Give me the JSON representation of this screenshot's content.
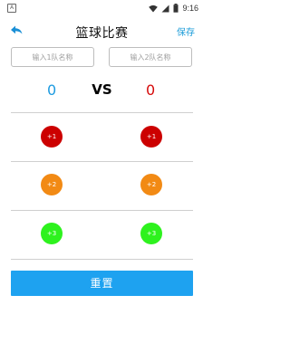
{
  "status_bar": {
    "time": "9:16",
    "notification_icon": "A"
  },
  "app_bar": {
    "title": "篮球比赛",
    "save_label": "保存"
  },
  "teams": {
    "team1_placeholder": "输入1队名称",
    "team2_placeholder": "输入2队名称",
    "team1_value": "",
    "team2_value": ""
  },
  "scores": {
    "team1": "0",
    "vs": "VS",
    "team2": "0"
  },
  "buttons": {
    "plus1": "+1",
    "plus2": "+2",
    "plus3": "+3",
    "reset": "重置"
  },
  "colors": {
    "accent": "#1ea2f0",
    "team1_score": "#1e9be0",
    "team2_score": "#d60b0b",
    "plus1": "#cc0000",
    "plus2": "#f28a14",
    "plus3": "#2ef21e"
  }
}
